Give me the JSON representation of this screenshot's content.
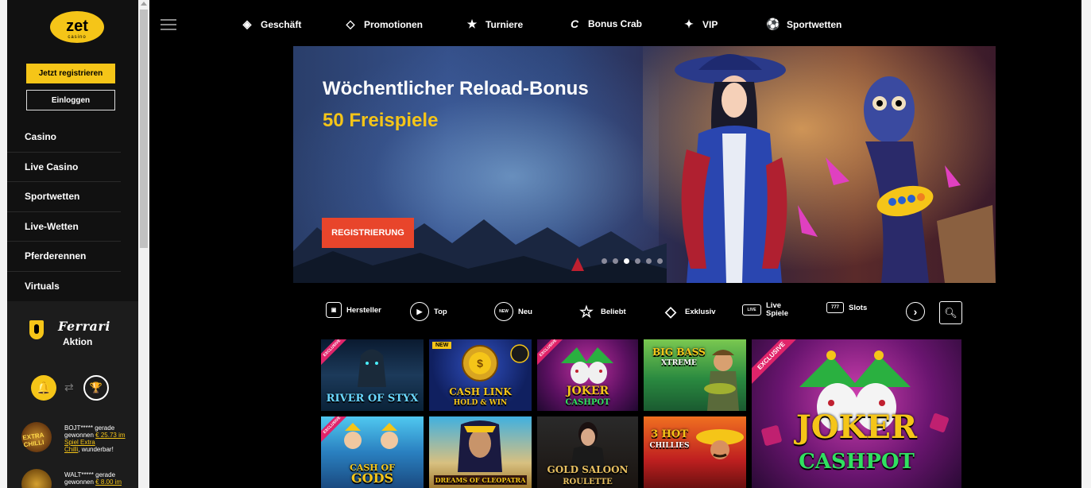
{
  "sidebar": {
    "logo_text": "zet",
    "logo_sub": "casino",
    "register_label": "Jetzt registrieren",
    "login_label": "Einloggen",
    "nav": [
      {
        "label": "Casino"
      },
      {
        "label": "Live Casino"
      },
      {
        "label": "Sportwetten"
      },
      {
        "label": "Live-Wetten"
      },
      {
        "label": "Pferderennen"
      },
      {
        "label": "Virtuals"
      }
    ],
    "promo_brand": "Ferrari",
    "promo_label": "Aktion",
    "winners": [
      {
        "thumb": "EXTRA CHILLI",
        "line1": "BOJT***** gerade",
        "line2_prefix": "gewonnen ",
        "amount": "€ 25.73 im",
        "game": "Spiel Extra",
        "game2": "Chilli",
        "suffix": ", wunderbar!"
      },
      {
        "thumb": "",
        "line1": "WALT***** gerade",
        "line2_prefix": "gewonnen ",
        "amount": "€ 8.00 im",
        "game": "",
        "game2": "",
        "suffix": ""
      }
    ]
  },
  "topnav": {
    "items": [
      {
        "label": "Geschäft",
        "icon": "diamond-tag-icon",
        "glyph": "◈"
      },
      {
        "label": "Promotionen",
        "icon": "gem-icon",
        "glyph": "◇"
      },
      {
        "label": "Turniere",
        "icon": "star-trophy-icon",
        "glyph": "★"
      },
      {
        "label": "Bonus Crab",
        "icon": "crab-c-icon",
        "glyph": "C"
      },
      {
        "label": "VIP",
        "icon": "sparkle-icon",
        "glyph": "✦"
      },
      {
        "label": "Sportwetten",
        "icon": "soccer-ball-icon",
        "glyph": "⚽"
      }
    ]
  },
  "banner": {
    "title": "Wöchentlicher Reload-Bonus",
    "subtitle": "50 Freispiele",
    "cta_label": "REGISTRIERUNG",
    "active_slide": 3,
    "slide_count": 6
  },
  "categories": [
    {
      "label": "Hersteller",
      "icon": "providers-icon",
      "glyph": "▣"
    },
    {
      "label": "Top",
      "icon": "play-icon",
      "glyph": "▶"
    },
    {
      "label": "Neu",
      "icon": "new-icon",
      "glyph": "NEW"
    },
    {
      "label": "Beliebt",
      "icon": "star-icon",
      "glyph": "☆"
    },
    {
      "label": "Exklusiv",
      "icon": "diamond-icon",
      "glyph": "◇"
    },
    {
      "label": "Live",
      "label2": "Spiele",
      "icon": "live-icon",
      "glyph": "LIVE"
    },
    {
      "label": "Slots",
      "icon": "slots-icon",
      "glyph": "777"
    },
    {
      "label": "",
      "icon": "more-icon",
      "glyph": "›"
    }
  ],
  "games": [
    {
      "name": "RIVER OF STYX",
      "badge": "exclusive"
    },
    {
      "name": "CASH LINK",
      "name2": "HOLD & WIN",
      "badge": "new"
    },
    {
      "name": "JOKER",
      "name2": "CASHPOT",
      "badge": "exclusive"
    },
    {
      "name": "BIG BASS",
      "name2": "XTREME",
      "badge": ""
    },
    {
      "name": "JOKER",
      "name2": "CASHPOT",
      "badge": "exclusive"
    },
    {
      "name": "CASH OF",
      "name2": "GODS",
      "badge": "exclusive"
    },
    {
      "name": "DREAMS OF CLEOPATRA",
      "badge": ""
    },
    {
      "name": "GOLD SALOON",
      "name2": "ROULETTE",
      "badge": ""
    },
    {
      "name": "3 HOT",
      "name2": "CHILLIES",
      "badge": ""
    }
  ],
  "badge_labels": {
    "exclusive": "EXCLUSIVE",
    "new": "NEW"
  },
  "colors": {
    "accent": "#f5c518",
    "cta": "#e8452b",
    "background": "#000000",
    "sidebar": "#1c1c1c"
  }
}
